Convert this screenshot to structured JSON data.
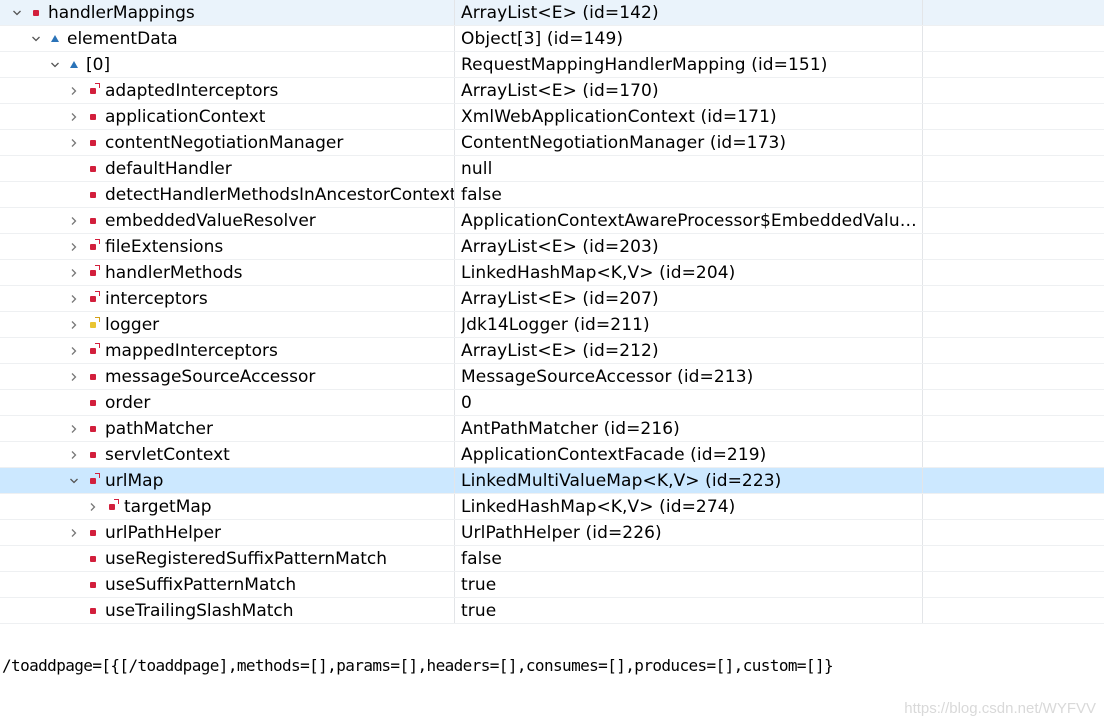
{
  "variables": [
    {
      "name": "handlerMappings",
      "value": "ArrayList<E>  (id=142)",
      "depth": 0,
      "expander": "down",
      "icon": "field-private",
      "selected": false
    },
    {
      "name": "elementData",
      "value": "Object[3]  (id=149)",
      "depth": 1,
      "expander": "down",
      "icon": "field-protected",
      "selected": false
    },
    {
      "name": "[0]",
      "value": "RequestMappingHandlerMapping  (id=151)",
      "depth": 2,
      "expander": "down",
      "icon": "field-protected",
      "selected": false
    },
    {
      "name": "adaptedInterceptors",
      "value": "ArrayList<E>  (id=170)",
      "depth": 3,
      "expander": "right",
      "icon": "field-private-final",
      "selected": false
    },
    {
      "name": "applicationContext",
      "value": "XmlWebApplicationContext  (id=171)",
      "depth": 3,
      "expander": "right",
      "icon": "field-private",
      "selected": false
    },
    {
      "name": "contentNegotiationManager",
      "value": "ContentNegotiationManager  (id=173)",
      "depth": 3,
      "expander": "right",
      "icon": "field-private",
      "selected": false
    },
    {
      "name": "defaultHandler",
      "value": "null",
      "depth": 3,
      "expander": "none",
      "icon": "field-private",
      "selected": false
    },
    {
      "name": "detectHandlerMethodsInAncestorContexts",
      "value": "false",
      "depth": 3,
      "expander": "none",
      "icon": "field-private",
      "selected": false
    },
    {
      "name": "embeddedValueResolver",
      "value": "ApplicationContextAwareProcessor$EmbeddedValu…",
      "depth": 3,
      "expander": "right",
      "icon": "field-private",
      "selected": false
    },
    {
      "name": "fileExtensions",
      "value": "ArrayList<E>  (id=203)",
      "depth": 3,
      "expander": "right",
      "icon": "field-private-final",
      "selected": false
    },
    {
      "name": "handlerMethods",
      "value": "LinkedHashMap<K,V>  (id=204)",
      "depth": 3,
      "expander": "right",
      "icon": "field-private-final",
      "selected": false
    },
    {
      "name": "interceptors",
      "value": "ArrayList<E>  (id=207)",
      "depth": 3,
      "expander": "right",
      "icon": "field-private-final",
      "selected": false
    },
    {
      "name": "logger",
      "value": "Jdk14Logger  (id=211)",
      "depth": 3,
      "expander": "right",
      "icon": "field-protected-final",
      "selected": false
    },
    {
      "name": "mappedInterceptors",
      "value": "ArrayList<E>  (id=212)",
      "depth": 3,
      "expander": "right",
      "icon": "field-private-final",
      "selected": false
    },
    {
      "name": "messageSourceAccessor",
      "value": "MessageSourceAccessor  (id=213)",
      "depth": 3,
      "expander": "right",
      "icon": "field-private",
      "selected": false
    },
    {
      "name": "order",
      "value": "0",
      "depth": 3,
      "expander": "none",
      "icon": "field-private",
      "selected": false
    },
    {
      "name": "pathMatcher",
      "value": "AntPathMatcher  (id=216)",
      "depth": 3,
      "expander": "right",
      "icon": "field-private",
      "selected": false
    },
    {
      "name": "servletContext",
      "value": "ApplicationContextFacade  (id=219)",
      "depth": 3,
      "expander": "right",
      "icon": "field-private",
      "selected": false
    },
    {
      "name": "urlMap",
      "value": "LinkedMultiValueMap<K,V>  (id=223)",
      "depth": 3,
      "expander": "down",
      "icon": "field-private-final",
      "selected": true
    },
    {
      "name": "targetMap",
      "value": "LinkedHashMap<K,V>  (id=274)",
      "depth": 4,
      "expander": "right",
      "icon": "field-private-final",
      "selected": false
    },
    {
      "name": "urlPathHelper",
      "value": "UrlPathHelper  (id=226)",
      "depth": 3,
      "expander": "right",
      "icon": "field-private",
      "selected": false
    },
    {
      "name": "useRegisteredSuffixPatternMatch",
      "value": "false",
      "depth": 3,
      "expander": "none",
      "icon": "field-private",
      "selected": false
    },
    {
      "name": "useSuffixPatternMatch",
      "value": "true",
      "depth": 3,
      "expander": "none",
      "icon": "field-private",
      "selected": false
    },
    {
      "name": "useTrailingSlashMatch",
      "value": "true",
      "depth": 3,
      "expander": "none",
      "icon": "field-private",
      "selected": false
    }
  ],
  "detail_text": "/toaddpage=[{[/toaddpage],methods=[],params=[],headers=[],consumes=[],produces=[],custom=[]}",
  "watermark": "https://blog.csdn.net/WYFVV",
  "colors": {
    "selected_row": "#cce8ff",
    "private_field": "#d21f3c",
    "protected_field": "#2a73b8",
    "static_field": "#e9c431"
  }
}
